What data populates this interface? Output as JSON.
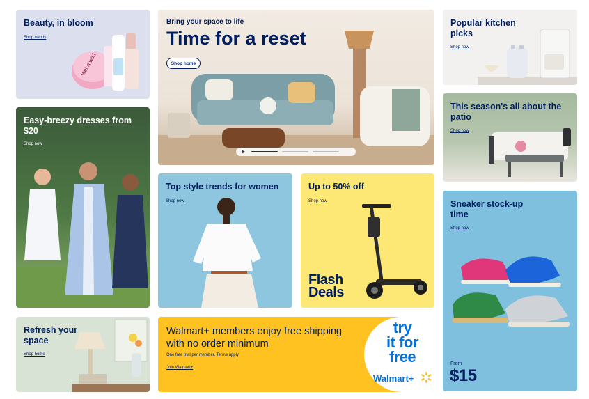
{
  "tiles": {
    "beauty": {
      "title": "Beauty, in bloom",
      "link": "Shop trends",
      "bg": "#dde0ee"
    },
    "dresses": {
      "title": "Easy-breezy dresses from $20",
      "link": "Shop now"
    },
    "hero": {
      "kicker": "Bring your space to life",
      "title": "Time for a reset",
      "button": "Shop home",
      "carousel_dots": 3
    },
    "kitchen": {
      "title": "Popular kitchen picks",
      "link": "Shop now"
    },
    "patio": {
      "title": "This season's all about the patio",
      "link": "Shop now"
    },
    "style": {
      "title": "Top style trends for women",
      "link": "Shop now"
    },
    "deals": {
      "title": "Up to 50% off",
      "link": "Shop now",
      "badge_line1": "Flash",
      "badge_line2": "Deals"
    },
    "sneaker": {
      "title": "Sneaker stock-up time",
      "link": "Shop now",
      "from_label": "From",
      "price": "$15"
    },
    "refresh": {
      "title": "Refresh your space",
      "link": "Shop home"
    },
    "walmartplus": {
      "headline": "Walmart+ members enjoy free shipping with no order minimum",
      "fineprint": "One free trial per member. Terms apply.",
      "link": "Join Walmart+",
      "promo_line1": "try",
      "promo_line2": "it for",
      "promo_line3": "free",
      "brand": "Walmart+"
    }
  },
  "colors": {
    "navy": "#001e60",
    "walmart_blue": "#0071dc",
    "spark_yellow": "#ffc220",
    "deals_yellow": "#fde775"
  }
}
